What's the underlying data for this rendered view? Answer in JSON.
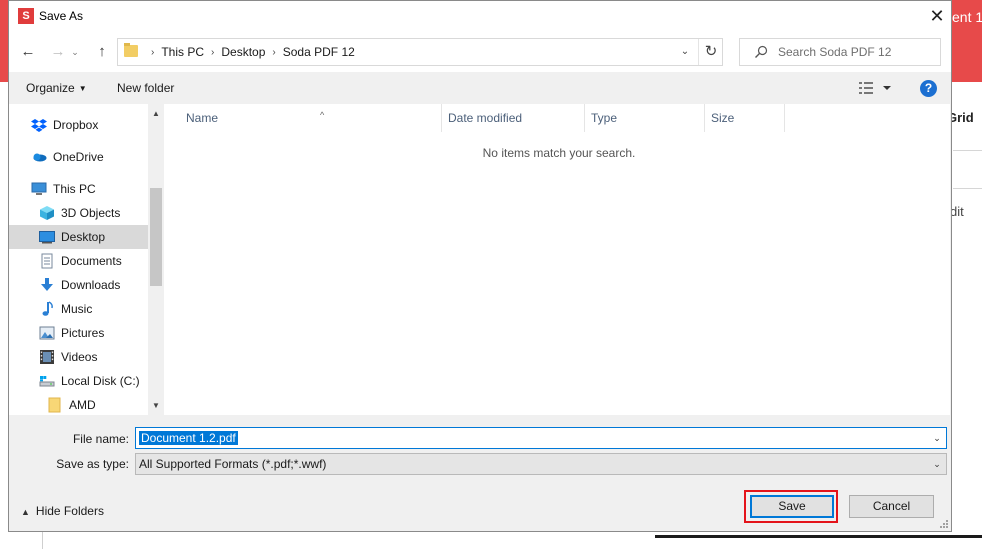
{
  "background_app": {
    "title_fragment": "ent 1",
    "grid_fragment": "Grid",
    "edit_fragment": "dit",
    "accent": "#e74a4a"
  },
  "dialog": {
    "app_icon_letter": "S",
    "title": "Save As",
    "close_glyph": "✕"
  },
  "nav": {
    "back_glyph": "←",
    "forward_glyph": "→",
    "recent_glyph": "⌄",
    "up_glyph": "↑"
  },
  "address": {
    "crumbs": [
      "This PC",
      "Desktop",
      "Soda PDF 12"
    ],
    "separator": "›",
    "dropdown_glyph": "⌄",
    "refresh_glyph": "↻"
  },
  "search": {
    "placeholder": "Search Soda PDF 12"
  },
  "toolbar": {
    "organize_label": "Organize",
    "organize_caret": "▼",
    "new_folder_label": "New folder",
    "help_label": "?"
  },
  "sidebar": {
    "items": [
      {
        "label": "Dropbox",
        "icon": "dropbox-icon"
      },
      {
        "label": "OneDrive",
        "icon": "onedrive-icon"
      },
      {
        "label": "This PC",
        "icon": "this-pc-icon"
      },
      {
        "label": "3D Objects",
        "icon": "3d-objects-icon"
      },
      {
        "label": "Desktop",
        "icon": "desktop-icon",
        "selected": true
      },
      {
        "label": "Documents",
        "icon": "documents-icon"
      },
      {
        "label": "Downloads",
        "icon": "downloads-icon"
      },
      {
        "label": "Music",
        "icon": "music-icon"
      },
      {
        "label": "Pictures",
        "icon": "pictures-icon"
      },
      {
        "label": "Videos",
        "icon": "videos-icon"
      },
      {
        "label": "Local Disk (C:)",
        "icon": "local-disk-icon"
      },
      {
        "label": "AMD",
        "icon": "folder-icon"
      }
    ],
    "scroll_up_glyph": "▲",
    "scroll_down_glyph": "▼"
  },
  "filelist": {
    "columns": [
      "Name",
      "Date modified",
      "Type",
      "Size"
    ],
    "sort_glyph": "^",
    "empty_message": "No items match your search."
  },
  "form": {
    "filename_label": "File name:",
    "filename_value": "Document 1.2.pdf",
    "savetype_label": "Save as type:",
    "savetype_value": "All Supported Formats (*.pdf;*.wwf)",
    "caret_glyph": "⌄"
  },
  "footer": {
    "hide_folders_caret": "▲",
    "hide_folders_label": "Hide Folders",
    "save_label": "Save",
    "cancel_label": "Cancel",
    "highlight_color": "#e4141b"
  }
}
